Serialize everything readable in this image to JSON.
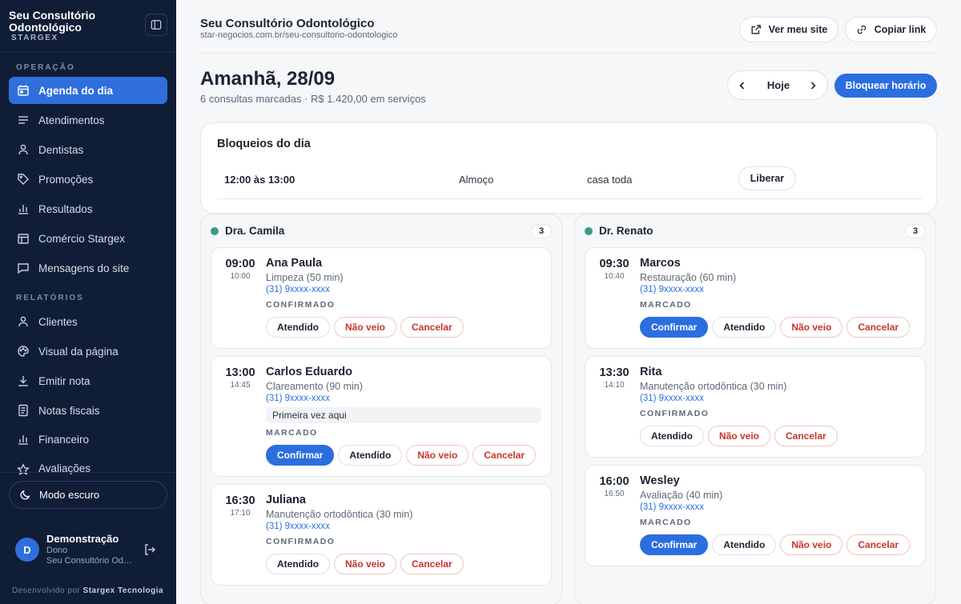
{
  "sidebar": {
    "brand_name": "Seu Consultório Odontológico",
    "brand_sub": "STARGEX",
    "section_operacao": "OPERAÇÃO",
    "section_relatorios": "RELATÓRIOS",
    "items_operacao": [
      {
        "label": "Agenda do dia",
        "icon": "calendar-icon",
        "active": true
      },
      {
        "label": "Atendimentos",
        "icon": "list-icon"
      },
      {
        "label": "Dentistas",
        "icon": "user-icon"
      },
      {
        "label": "Promoções",
        "icon": "tag-icon"
      },
      {
        "label": "Resultados",
        "icon": "bar-chart-icon"
      },
      {
        "label": "Comércio Stargex",
        "icon": "store-icon"
      },
      {
        "label": "Mensagens do site",
        "icon": "message-icon"
      }
    ],
    "items_relatorios": [
      {
        "label": "Clientes",
        "icon": "user-icon"
      },
      {
        "label": "Visual da página",
        "icon": "palette-icon"
      },
      {
        "label": "Emitir nota",
        "icon": "download-icon"
      },
      {
        "label": "Notas fiscais",
        "icon": "receipt-icon"
      },
      {
        "label": "Financeiro",
        "icon": "bar-chart-icon"
      },
      {
        "label": "Avaliações",
        "icon": "star-icon"
      }
    ],
    "dark_mode": "Modo escuro",
    "user": {
      "initial": "D",
      "name": "Demonstração",
      "role": "Dono",
      "org": "Seu Consultório Odontológico"
    },
    "credit_prefix": "Desenvolvido por",
    "credit_brand": "Stargex Tecnologia"
  },
  "header": {
    "title": "Seu Consultório Odontológico",
    "url": "star-negocios.com.br/seu-consultorio-odontologico",
    "view_site": "Ver meu site",
    "copy_link": "Copiar link"
  },
  "day": {
    "title": "Amanhã, 28/09",
    "subtitle": "6 consultas marcadas · R$ 1.420,00 em serviços",
    "today": "Hoje",
    "block_button": "Bloquear horário"
  },
  "blocks": {
    "title": "Bloqueios do dia",
    "rows": [
      {
        "time": "12:00 às 13:00",
        "reason": "Almoço",
        "scope": "casa toda",
        "action": "Liberar"
      }
    ]
  },
  "labels": {
    "confirm": "Confirmar",
    "attended": "Atendido",
    "noshow": "Não veio",
    "cancel": "Cancelar"
  },
  "columns": [
    {
      "doctor": "Dra. Camila",
      "count": "3",
      "appointments": [
        {
          "start": "09:00",
          "end": "10:00",
          "name": "Ana Paula",
          "service": "Limpeza (50 min)",
          "phone": "(31) 9xxxx-xxxx",
          "status": "CONFIRMADO"
        },
        {
          "start": "13:00",
          "end": "14:45",
          "name": "Carlos Eduardo",
          "service": "Clareamento (90 min)",
          "phone": "(31) 9xxxx-xxxx",
          "note": "Primeira vez aqui",
          "status": "MARCADO"
        },
        {
          "start": "16:30",
          "end": "17:10",
          "name": "Juliana",
          "service": "Manutenção ortodôntica (30 min)",
          "phone": "(31) 9xxxx-xxxx",
          "status": "CONFIRMADO"
        }
      ]
    },
    {
      "doctor": "Dr. Renato",
      "count": "3",
      "appointments": [
        {
          "start": "09:30",
          "end": "10:40",
          "name": "Marcos",
          "service": "Restauração (60 min)",
          "phone": "(31) 9xxxx-xxxx",
          "status": "MARCADO"
        },
        {
          "start": "13:30",
          "end": "14:10",
          "name": "Rita",
          "service": "Manutenção ortodôntica (30 min)",
          "phone": "(31) 9xxxx-xxxx",
          "status": "CONFIRMADO"
        },
        {
          "start": "16:00",
          "end": "16:50",
          "name": "Wesley",
          "service": "Avaliação (40 min)",
          "phone": "(31) 9xxxx-xxxx",
          "status": "MARCADO"
        }
      ]
    }
  ]
}
